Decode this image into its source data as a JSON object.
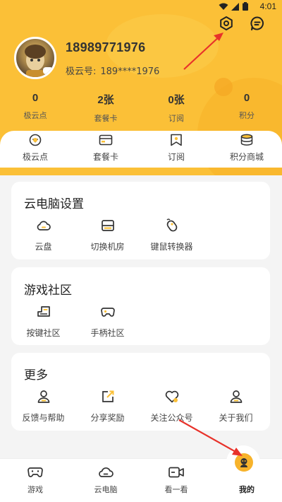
{
  "status_bar": {
    "time": "4:01"
  },
  "header": {
    "phone": "18989771976",
    "cloud_id_label": "极云号:",
    "cloud_id_value": "189****1976"
  },
  "stats": [
    {
      "value": "0",
      "label": "极云点"
    },
    {
      "value": "2张",
      "label": "套餐卡"
    },
    {
      "value": "0张",
      "label": "订阅"
    },
    {
      "value": "0",
      "label": "积分"
    }
  ],
  "quick_actions": [
    {
      "label": "极云点",
      "icon": "points-icon"
    },
    {
      "label": "套餐卡",
      "icon": "card-icon"
    },
    {
      "label": "订阅",
      "icon": "subscribe-icon"
    },
    {
      "label": "积分商城",
      "icon": "coins-icon"
    }
  ],
  "cloud_settings": {
    "title": "云电脑设置",
    "items": [
      {
        "label": "云盘",
        "icon": "cloud-disk-icon"
      },
      {
        "label": "切换机房",
        "icon": "switch-room-icon"
      },
      {
        "label": "键鼠转换器",
        "icon": "mouse-icon"
      }
    ]
  },
  "community": {
    "title": "游戏社区",
    "items": [
      {
        "label": "按键社区",
        "icon": "keys-icon"
      },
      {
        "label": "手柄社区",
        "icon": "gamepad-icon"
      }
    ]
  },
  "more": {
    "title": "更多",
    "items": [
      {
        "label": "反馈与帮助",
        "icon": "user-help-icon"
      },
      {
        "label": "分享奖励",
        "icon": "share-icon"
      },
      {
        "label": "关注公众号",
        "icon": "heart-icon"
      },
      {
        "label": "关于我们",
        "icon": "user-icon"
      }
    ]
  },
  "bottom_nav": {
    "items": [
      {
        "label": "游戏",
        "icon": "game-icon"
      },
      {
        "label": "云电脑",
        "icon": "cloud-pc-icon"
      },
      {
        "label": "看一看",
        "icon": "video-icon"
      },
      {
        "label": "我的",
        "icon": "profile-icon"
      }
    ],
    "active_index": 3
  },
  "colors": {
    "accent": "#fbc037",
    "active_dot": "#f7b32b",
    "annotation_arrow": "#e8322a"
  }
}
